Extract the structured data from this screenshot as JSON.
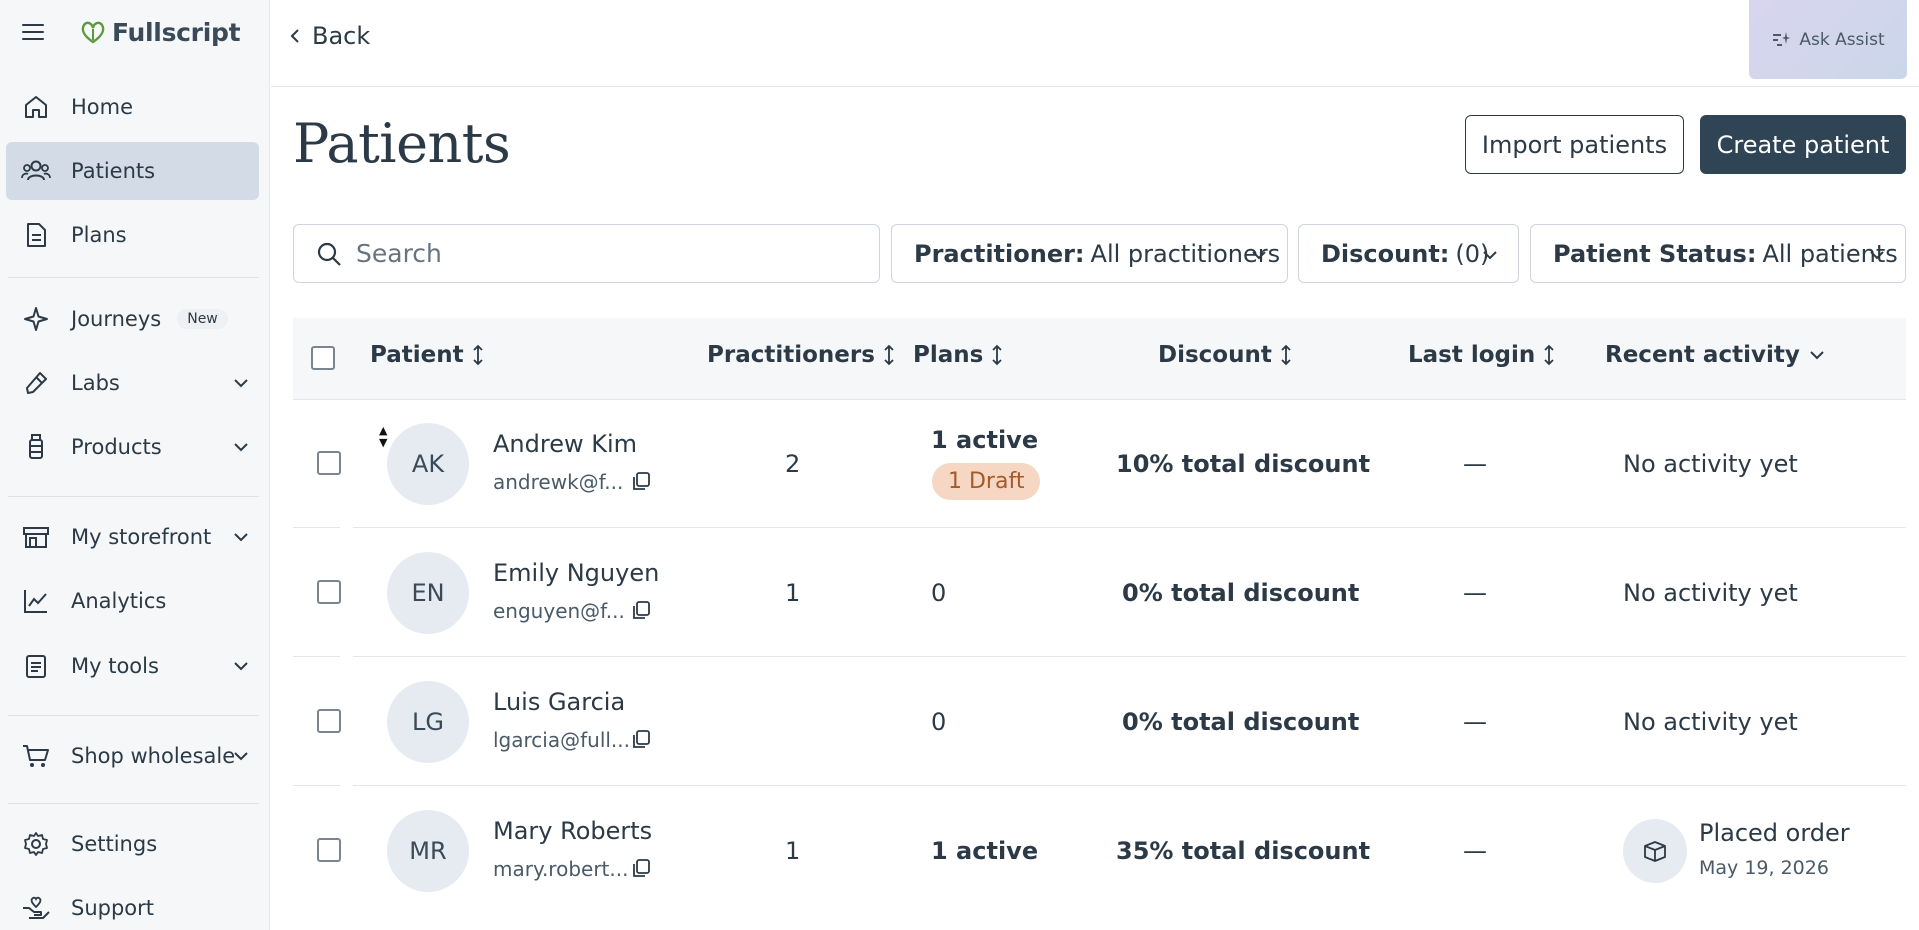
{
  "app": {
    "logo_text": "Fullscript"
  },
  "sidebar": {
    "items": [
      {
        "label": "Home"
      },
      {
        "label": "Patients"
      },
      {
        "label": "Plans"
      },
      {
        "label": "Journeys",
        "badge": "New"
      },
      {
        "label": "Labs"
      },
      {
        "label": "Products"
      },
      {
        "label": "My storefront"
      },
      {
        "label": "Analytics"
      },
      {
        "label": "My tools"
      },
      {
        "label": "Shop wholesale"
      },
      {
        "label": "Settings"
      },
      {
        "label": "Support"
      }
    ]
  },
  "topbar": {
    "back_label": "Back",
    "assist_label": "Ask Assist"
  },
  "page": {
    "title": "Patients",
    "import_label": "Import patients",
    "create_label": "Create patient"
  },
  "search": {
    "placeholder": "Search"
  },
  "filters": {
    "practitioner": {
      "key": "Practitioner:",
      "value": "All practitioners"
    },
    "discount": {
      "key": "Discount:",
      "value": "(0)"
    },
    "status": {
      "key": "Patient Status:",
      "value": "All patients"
    }
  },
  "table": {
    "headers": [
      "Patient",
      "Practitioners",
      "Plans",
      "Discount",
      "Last login",
      "Recent activity"
    ],
    "rows": [
      {
        "initials": "AK",
        "name": "Andrew Kim",
        "email": "andrewk@f...",
        "practitioners": "2",
        "plans": "1 active",
        "draft": "1 Draft",
        "discount": "10% total discount",
        "last_login": "—",
        "activity": "No activity yet"
      },
      {
        "initials": "EN",
        "name": "Emily Nguyen",
        "email": "enguyen@f...",
        "practitioners": "1",
        "plans": "0",
        "discount": "0% total discount",
        "last_login": "—",
        "activity": "No activity yet"
      },
      {
        "initials": "LG",
        "name": "Luis Garcia",
        "email": "lgarcia@full...",
        "practitioners": "",
        "plans": "0",
        "discount": "0% total discount",
        "last_login": "—",
        "activity": "No activity yet"
      },
      {
        "initials": "MR",
        "name": "Mary Roberts",
        "email": "mary.robert...",
        "practitioners": "1",
        "plans": "1 active",
        "discount": "35% total discount",
        "last_login": "—",
        "activity": "Placed order",
        "activity_date": "May 19, 2026"
      }
    ]
  },
  "colors": {
    "active_nav": "#d2dbe6",
    "primary_button": "#2f4556",
    "draft_badge": "#f6d7c4",
    "sidebar_bg": "#f6f7f9"
  }
}
